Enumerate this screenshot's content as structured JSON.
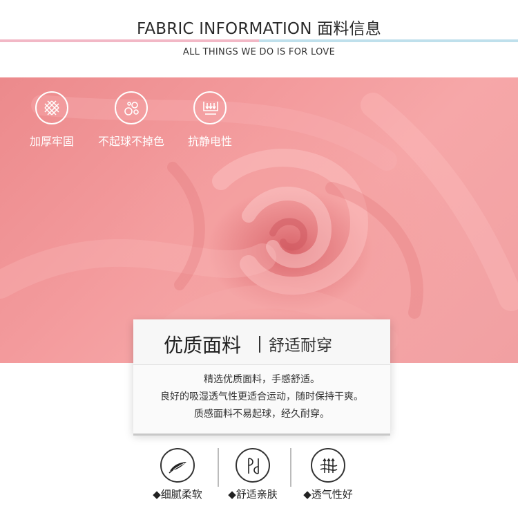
{
  "header": {
    "title": "FABRIC INFORMATION 面料信息",
    "subtitle": "ALL THINGS WE DO IS FOR LOVE"
  },
  "features": [
    {
      "label": "加厚牢固",
      "icon": "crosshatch-icon"
    },
    {
      "label": "不起球不掉色",
      "icon": "bubbles-icon"
    },
    {
      "label": "抗静电性",
      "icon": "antistatic-icon"
    }
  ],
  "panel": {
    "title": "优质面料",
    "subtitle": "舒适耐穿",
    "lines": [
      "精选优质面料，手感舒适。",
      "良好的吸湿透气性更适合运动，随时保持干爽。",
      "质感面料不易起球，经久耐穿。"
    ]
  },
  "badges": [
    {
      "label": "◆细腻柔软",
      "icon": "feather-icon"
    },
    {
      "label": "◆舒适亲肤",
      "icon": "skin-icon"
    },
    {
      "label": "◆透气性好",
      "icon": "breathable-icon"
    }
  ],
  "colors": {
    "fabric": "#f39a9c",
    "rule_pink": "#f2b8c6",
    "rule_blue": "#bfe0ec"
  }
}
